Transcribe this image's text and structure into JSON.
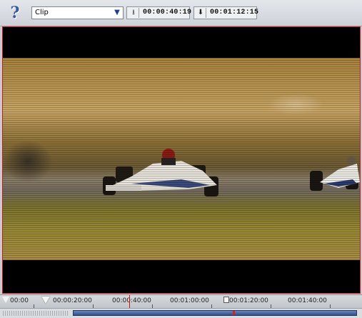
{
  "toolbar": {
    "help_icon": "question-mark-icon",
    "source_select": {
      "value": "Clip"
    },
    "mark_in": {
      "icon": "mark-in-icon",
      "time": "00:00:40:19"
    },
    "mark_out": {
      "icon": "mark-out-icon",
      "time": "00:01:12:15"
    }
  },
  "viewer": {
    "description_icon": "video-preview"
  },
  "timeline": {
    "ruler_labels": [
      "00:00",
      "00:00:20:00",
      "00:00:40:00",
      "00:01:00:00",
      "00:01:20:00",
      "00:01:40:00"
    ],
    "playhead_color": "#d01010"
  },
  "colors": {
    "accent": "#c21b1b",
    "scroll_thumb": "#2f4f8c"
  }
}
